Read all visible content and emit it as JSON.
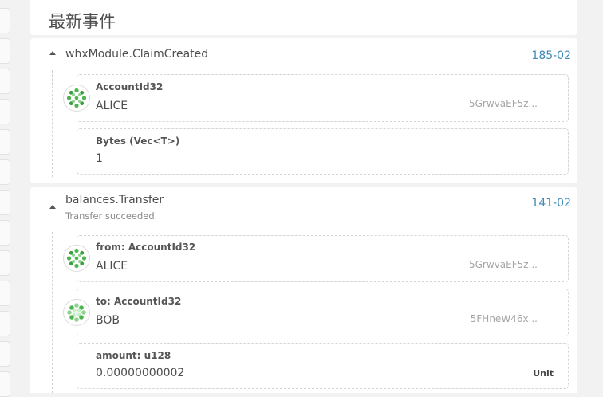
{
  "section": {
    "title": "最新事件"
  },
  "events": [
    {
      "title": "whxModule.ClaimCreated",
      "block": "185-02",
      "params": [
        {
          "label": "AccountId32",
          "value": "ALICE",
          "address": "5GrwvaEF5z...",
          "avatar": "identicon-alice"
        },
        {
          "label": "Bytes (Vec<T>)",
          "value": "1"
        }
      ]
    },
    {
      "title": "balances.Transfer",
      "description": "Transfer succeeded.",
      "block": "141-02",
      "params": [
        {
          "label": "from: AccountId32",
          "value": "ALICE",
          "address": "5GrwvaEF5z...",
          "avatar": "identicon-alice"
        },
        {
          "label": "to: AccountId32",
          "value": "BOB",
          "address": "5FHneW46x...",
          "avatar": "identicon-bob"
        },
        {
          "label": "amount: u128",
          "value": "0.00000000002",
          "unit": "Unit"
        }
      ]
    }
  ],
  "colors": {
    "block_link": "#3e8bb7",
    "identicon_green": "#4cb54f"
  }
}
